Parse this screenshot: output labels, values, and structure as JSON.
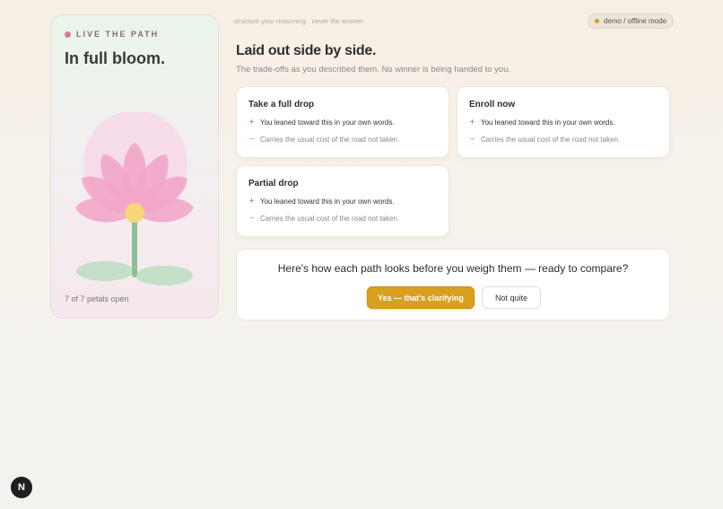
{
  "left_panel": {
    "eyebrow": "LIVE THE PATH",
    "title": "In full bloom.",
    "petals_status": "7 of 7 petals open",
    "petals_open": 7,
    "petals_total": 7
  },
  "header": {
    "tagline": "structure your reasoning · never the answer",
    "mode_badge": "demo / offline mode"
  },
  "main": {
    "title": "Laid out side by side.",
    "subtitle": "The trade-offs as you described them. No winner is being handed to you."
  },
  "options": [
    {
      "title": "Take a full drop",
      "pro": "You leaned toward this in your own words.",
      "con": "Carries the usual cost of the road not taken."
    },
    {
      "title": "Enroll now",
      "pro": "You leaned toward this in your own words.",
      "con": "Carries the usual cost of the road not taken."
    },
    {
      "title": "Partial drop",
      "pro": "You leaned toward this in your own words.",
      "con": "Carries the usual cost of the road not taken."
    }
  ],
  "confirm": {
    "question": "Here's how each path looks before you weigh them — ready to compare?",
    "yes_label": "Yes — that's clarifying",
    "no_label": "Not quite"
  },
  "badge": {
    "letter": "N"
  },
  "colors": {
    "accent": "#d9a020",
    "pro_sign": "#4e9a7a",
    "con_sign": "#d89a2a",
    "petal": "#f2a6c8",
    "stem": "#8cbf96"
  },
  "icons": {
    "pro": "plus-icon",
    "con": "minus-icon",
    "flower": "lotus-illustration",
    "badge": "n-logo-icon"
  }
}
